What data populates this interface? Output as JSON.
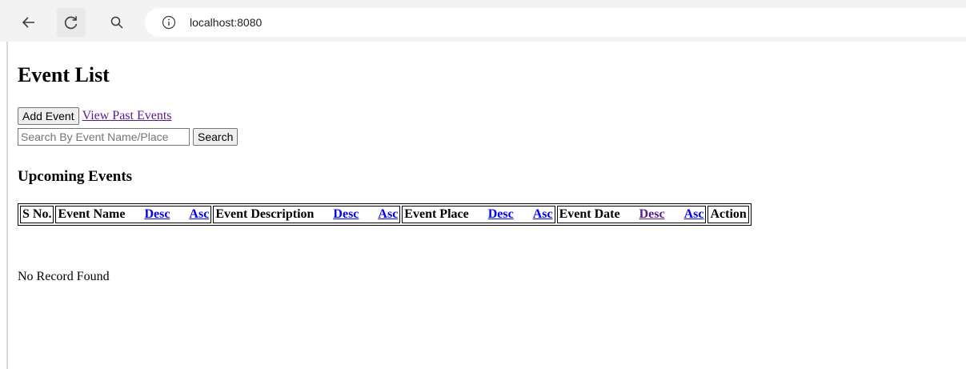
{
  "browser": {
    "url": "localhost:8080"
  },
  "page": {
    "title": "Event List",
    "add_event_label": "Add Event",
    "view_past_events_label": "View Past Events",
    "search": {
      "placeholder": "Search By Event Name/Place",
      "button_label": "Search"
    },
    "section_title": "Upcoming Events",
    "table": {
      "headers": {
        "sno": "S No.",
        "event_name": "Event Name",
        "event_description": "Event Description",
        "event_place": "Event Place",
        "event_date": "Event Date",
        "action": "Action"
      },
      "sort_desc_label": "Desc",
      "sort_asc_label": "Asc"
    },
    "empty_message": "No Record Found"
  }
}
